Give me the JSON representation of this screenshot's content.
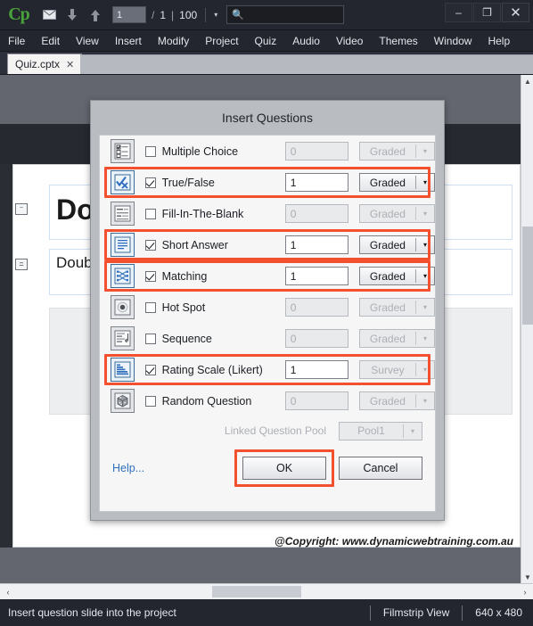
{
  "titlebar": {
    "logo": "Cp",
    "icons": [
      "mail-icon",
      "arrow-down-icon",
      "arrow-up-icon"
    ],
    "page_current": "1",
    "page_sep": "/",
    "page_total": "1",
    "pipe": "|",
    "zoom": "100",
    "caret": "▾",
    "search_placeholder": "",
    "search_value": "",
    "minimize": "–",
    "maximize": "❐",
    "close": "✕"
  },
  "menubar": {
    "items": [
      "File",
      "Edit",
      "View",
      "Insert",
      "Modify",
      "Project",
      "Quiz",
      "Audio",
      "Video",
      "Themes",
      "Window",
      "Help"
    ]
  },
  "tabbar": {
    "document_tab": "Quiz.cptx",
    "close_glyph": "✕"
  },
  "canvas": {
    "title_placeholder": "Double",
    "subtitle_placeholder": "Double",
    "collapse_glyph_1": "⁻",
    "collapse_glyph_2": "=",
    "copyright": "@Copyright: www.dynamicwebtraining.com.au"
  },
  "scrollbars": {
    "up_arrow": "▲",
    "down_arrow": "▼",
    "left_arrow": "‹",
    "right_arrow": "›"
  },
  "statusbar": {
    "message": "Insert question slide into the project",
    "view_mode": "Filmstrip View",
    "dimensions": "640 x 480"
  },
  "dialog": {
    "title": "Insert Questions",
    "rows": [
      {
        "icon": "multiple-choice-icon",
        "label": "Multiple Choice",
        "checked": false,
        "count": "0",
        "type": "Graded",
        "enabled": false,
        "highlighted": false
      },
      {
        "icon": "true-false-icon",
        "label": "True/False",
        "checked": true,
        "count": "1",
        "type": "Graded",
        "enabled": true,
        "highlighted": true
      },
      {
        "icon": "fill-blank-icon",
        "label": "Fill-In-The-Blank",
        "checked": false,
        "count": "0",
        "type": "Graded",
        "enabled": false,
        "highlighted": false
      },
      {
        "icon": "short-answer-icon",
        "label": "Short Answer",
        "checked": true,
        "count": "1",
        "type": "Graded",
        "enabled": true,
        "highlighted": true
      },
      {
        "icon": "matching-icon",
        "label": "Matching",
        "checked": true,
        "count": "1",
        "type": "Graded",
        "enabled": true,
        "highlighted": true
      },
      {
        "icon": "hot-spot-icon",
        "label": "Hot Spot",
        "checked": false,
        "count": "0",
        "type": "Graded",
        "enabled": false,
        "highlighted": false
      },
      {
        "icon": "sequence-icon",
        "label": "Sequence",
        "checked": false,
        "count": "0",
        "type": "Graded",
        "enabled": false,
        "highlighted": false
      },
      {
        "icon": "rating-scale-icon",
        "label": "Rating Scale (Likert)",
        "checked": true,
        "count": "1",
        "type": "Survey",
        "enabled": true,
        "highlighted": true,
        "type_enabled": false
      },
      {
        "icon": "random-question-icon",
        "label": "Random Question",
        "checked": false,
        "count": "0",
        "type": "Graded",
        "enabled": false,
        "highlighted": false
      }
    ],
    "pool_label": "Linked Question Pool",
    "pool_value": "Pool1",
    "help_label": "Help...",
    "ok_label": "OK",
    "cancel_label": "Cancel",
    "dropdown_arrow": "▾",
    "highlight_color": "#f2502e"
  }
}
